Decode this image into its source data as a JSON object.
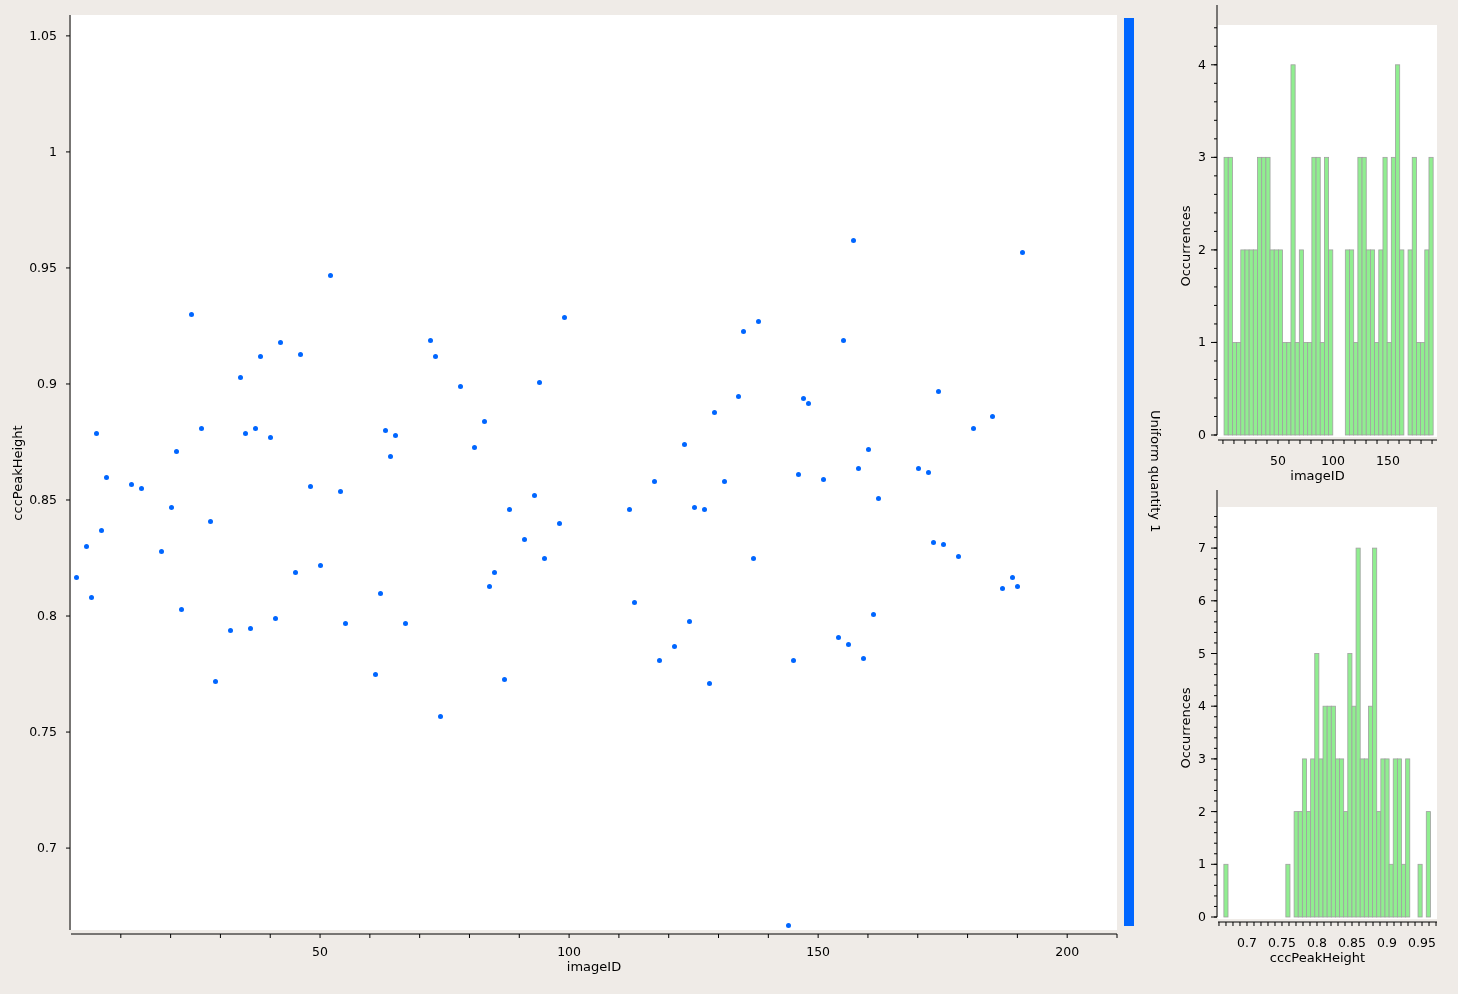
{
  "scatter": {
    "chart_data": {
      "type": "scatter",
      "xlabel": "imageID",
      "ylabel": "cccPeakHeight",
      "xlim": [
        0,
        210
      ],
      "ylim": [
        0.6647,
        1.059
      ],
      "xticks": [
        50,
        100,
        150,
        200
      ],
      "yticks": [
        0.7,
        0.75,
        0.8,
        0.85,
        0.9,
        0.95,
        1,
        1.05
      ],
      "series": [
        {
          "color": "#0066ff",
          "x": [
            1,
            3,
            4,
            5,
            6,
            7,
            12,
            14,
            18,
            20,
            21,
            22,
            24,
            26,
            28,
            29,
            32,
            34,
            35,
            36,
            37,
            38,
            40,
            41,
            42,
            45,
            46,
            48,
            50,
            52,
            54,
            55,
            61,
            62,
            63,
            64,
            65,
            67,
            72,
            73,
            74,
            78,
            81,
            83,
            84,
            85,
            87,
            88,
            91,
            93,
            94,
            95,
            98,
            99,
            112,
            113,
            117,
            118,
            121,
            123,
            124,
            125,
            127,
            128,
            129,
            131,
            134,
            135,
            137,
            138,
            144,
            145,
            146,
            147,
            148,
            151,
            154,
            155,
            156,
            157,
            158,
            159,
            160,
            161,
            162,
            170,
            172,
            173,
            174,
            175,
            178,
            181,
            185,
            187,
            189,
            190,
            191
          ],
          "values": [
            0.817,
            0.83,
            0.808,
            0.879,
            0.837,
            0.86,
            0.857,
            0.855,
            0.828,
            0.847,
            0.871,
            0.803,
            0.93,
            0.881,
            0.841,
            0.772,
            0.794,
            0.903,
            0.879,
            0.795,
            0.881,
            0.912,
            0.877,
            0.799,
            0.918,
            0.819,
            0.913,
            0.856,
            0.822,
            0.947,
            0.854,
            0.797,
            0.775,
            0.81,
            0.88,
            0.869,
            0.878,
            0.797,
            0.919,
            0.912,
            0.757,
            0.899,
            0.873,
            0.884,
            0.813,
            0.819,
            0.773,
            0.846,
            0.833,
            0.852,
            0.901,
            0.825,
            0.84,
            0.929,
            0.846,
            0.806,
            0.858,
            0.781,
            0.787,
            0.874,
            0.798,
            0.847,
            0.846,
            0.771,
            0.888,
            0.858,
            0.895,
            0.923,
            0.825,
            0.927,
            0.667,
            0.781,
            0.861,
            0.894,
            0.892,
            0.859,
            0.791,
            0.919,
            0.788,
            0.962,
            0.864,
            0.782,
            0.872,
            0.801,
            0.851,
            0.864,
            0.862,
            0.832,
            0.897,
            0.831,
            0.826,
            0.881,
            0.886,
            0.812,
            0.817,
            0.813,
            0.957
          ]
        }
      ]
    }
  },
  "colorbar": {
    "label": "Uniform quantity 1"
  },
  "histograms": [
    {
      "chart_data": {
        "type": "bar",
        "xlabel": "imageID",
        "ylabel": "Occurrences",
        "xlim": [
          -4.5,
          194.5
        ],
        "ylim": [
          0,
          4.43
        ],
        "xticks": [
          50,
          100,
          150
        ],
        "yticks": [
          0,
          1,
          2,
          3,
          4
        ],
        "x": [
          1,
          4.8,
          8.6,
          12.4,
          16.2,
          20,
          23.8,
          27.6,
          31.4,
          35.2,
          39,
          42.8,
          46.6,
          50.4,
          54.2,
          58,
          61.8,
          65.6,
          69.4,
          73.2,
          77,
          80.8,
          84.6,
          88.4,
          92.2,
          96,
          99.8,
          103.6,
          107.4,
          111.2,
          115,
          118.8,
          122.6,
          126.4,
          130.2,
          134,
          137.8,
          141.6,
          145.4,
          149.2,
          153,
          156.8,
          160.6,
          164.4,
          168.2,
          172,
          175.8,
          179.6,
          183.4,
          187.2
        ],
        "values": [
          3,
          3,
          1,
          1,
          2,
          2,
          2,
          2,
          3,
          3,
          3,
          2,
          2,
          2,
          1,
          1,
          4,
          1,
          2,
          1,
          1,
          3,
          3,
          1,
          3,
          2,
          0,
          0,
          0,
          2,
          2,
          1,
          3,
          3,
          2,
          2,
          1,
          2,
          3,
          1,
          3,
          4,
          2,
          0,
          2,
          3,
          1,
          1,
          2,
          3
        ]
      }
    },
    {
      "chart_data": {
        "type": "bar",
        "xlabel": "cccPeakHeight",
        "ylabel": "Occurrences",
        "xlim": [
          0.6586,
          0.9714
        ],
        "ylim": [
          0,
          7.78
        ],
        "xticks": [
          0.7,
          0.75,
          0.8,
          0.85,
          0.9,
          0.95
        ],
        "yticks": [
          0,
          1,
          2,
          3,
          4,
          5,
          6,
          7
        ],
        "x": [
          0.667,
          0.6729,
          0.6788,
          0.6847,
          0.6906,
          0.6965,
          0.7024,
          0.7083,
          0.7142,
          0.7201,
          0.726,
          0.7319,
          0.7378,
          0.7437,
          0.7496,
          0.7555,
          0.7614,
          0.7673,
          0.7732,
          0.7791,
          0.785,
          0.7909,
          0.7968,
          0.8027,
          0.8086,
          0.8145,
          0.8204,
          0.8263,
          0.8322,
          0.8381,
          0.844,
          0.8499,
          0.8558,
          0.8617,
          0.8676,
          0.8735,
          0.8794,
          0.8853,
          0.8912,
          0.8971,
          0.903,
          0.9089,
          0.9148,
          0.9207,
          0.9266,
          0.9325,
          0.9384,
          0.9443,
          0.9502,
          0.9561
        ],
        "values": [
          1,
          0,
          0,
          0,
          0,
          0,
          0,
          0,
          0,
          0,
          0,
          0,
          0,
          0,
          0,
          1,
          0,
          2,
          2,
          3,
          2,
          3,
          5,
          3,
          4,
          4,
          4,
          3,
          3,
          2,
          5,
          4,
          7,
          3,
          3,
          4,
          7,
          2,
          3,
          3,
          1,
          3,
          3,
          1,
          3,
          0,
          0,
          1,
          0,
          2
        ]
      }
    }
  ]
}
